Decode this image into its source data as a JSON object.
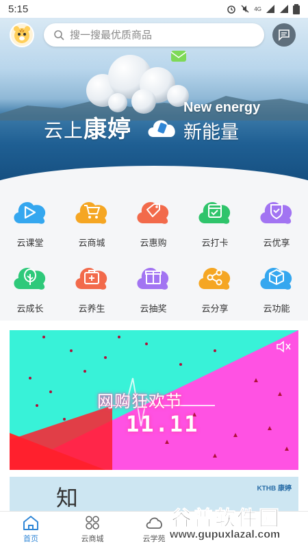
{
  "status_bar": {
    "time": "5:15",
    "network": "4G"
  },
  "header": {
    "search_placeholder": "搜一搜最优质商品",
    "icons": {
      "avatar": "cartoon-tiger-avatar",
      "search": "search-icon",
      "message": "chat-icon"
    }
  },
  "banner": {
    "title_prefix": "云上",
    "title_brand": "康婷",
    "energy_en": "New energy",
    "energy_cn": "新能量"
  },
  "grid": {
    "items": [
      {
        "label": "云课堂",
        "icon": "play-icon",
        "color": "#35a7ef"
      },
      {
        "label": "云商城",
        "icon": "cart-icon",
        "color": "#f5a623"
      },
      {
        "label": "云惠购",
        "icon": "tag-icon",
        "color": "#f26a4b"
      },
      {
        "label": "云打卡",
        "icon": "calendar-check-icon",
        "color": "#2fc46b"
      },
      {
        "label": "云优享",
        "icon": "shield-check-icon",
        "color": "#a274f2"
      },
      {
        "label": "云成长",
        "icon": "tree-icon",
        "color": "#2ec97a"
      },
      {
        "label": "云养生",
        "icon": "medkit-icon",
        "color": "#f26a4b"
      },
      {
        "label": "云抽奖",
        "icon": "gift-icon",
        "color": "#a274f2"
      },
      {
        "label": "云分享",
        "icon": "share-icon",
        "color": "#f5a623"
      },
      {
        "label": "云功能",
        "icon": "cube-icon",
        "color": "#35a7ef"
      }
    ]
  },
  "promo": {
    "title": "网购狂欢节",
    "number": "11.11",
    "colors": {
      "cyan": "#38f2d8",
      "magenta": "#ff52e3",
      "red": "#ff2a2a"
    }
  },
  "promo2": {
    "headline_char": "知",
    "brand_logo": "KTHB 康婷"
  },
  "bottom_nav": {
    "items": [
      {
        "label": "首页",
        "icon": "home-icon",
        "active": true
      },
      {
        "label": "云商城",
        "icon": "grid-dots-icon",
        "active": false
      },
      {
        "label": "云学苑",
        "icon": "cloud-icon",
        "active": false
      }
    ]
  },
  "watermark": {
    "cn": "谷普软件园",
    "url": "www.gupuxlazal.com"
  }
}
